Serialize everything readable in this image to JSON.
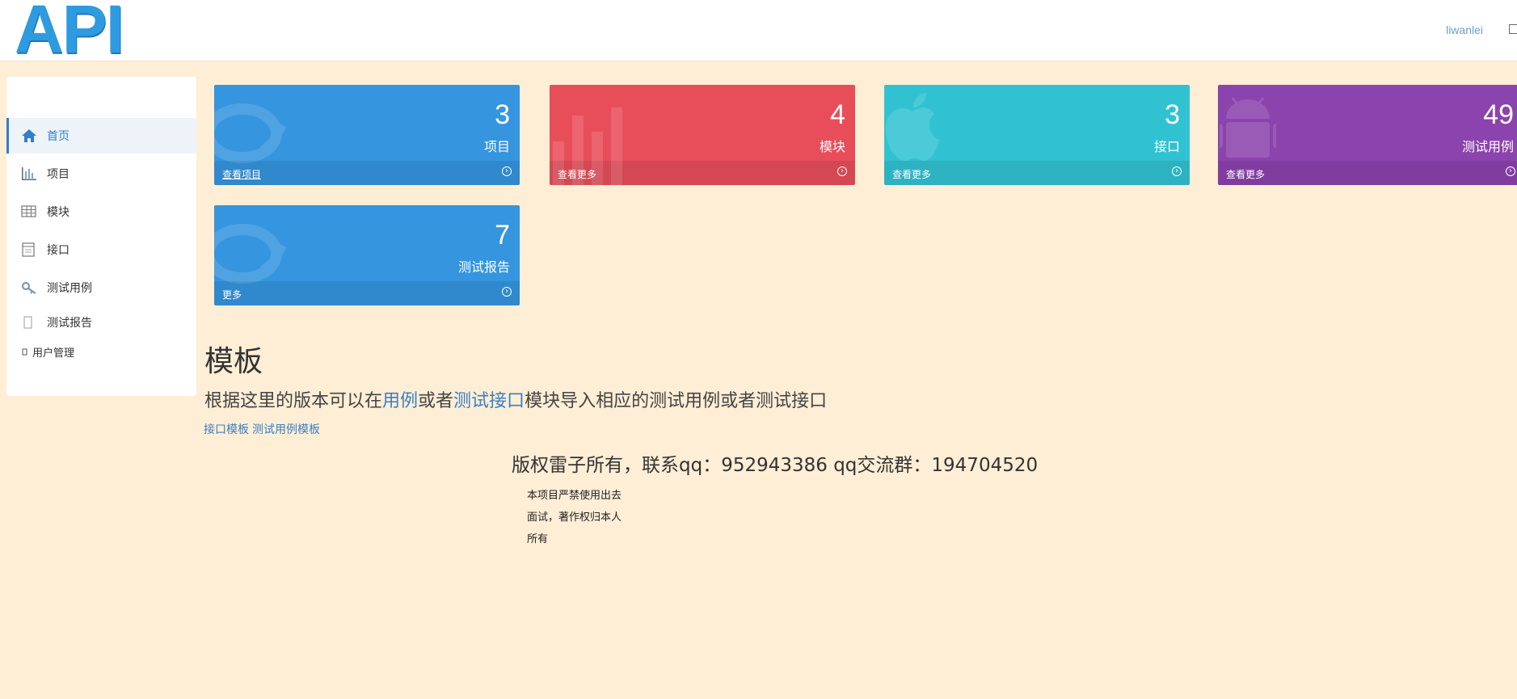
{
  "header": {
    "logo": "API",
    "username": "liwanlei"
  },
  "sidebar": {
    "items": [
      {
        "label": "首页",
        "icon": "home-icon"
      },
      {
        "label": "项目",
        "icon": "bar-chart-icon"
      },
      {
        "label": "模块",
        "icon": "table-icon"
      },
      {
        "label": "接口",
        "icon": "window-icon"
      },
      {
        "label": "测试用例",
        "icon": "key-icon"
      },
      {
        "label": "测试报告",
        "icon": "document-icon"
      },
      {
        "label": "用户管理",
        "icon": "user-icon"
      }
    ]
  },
  "cards": [
    {
      "count": "3",
      "label": "项目",
      "link": "查看项目",
      "color": "#3595de",
      "bg_icon": "chat-icon"
    },
    {
      "count": "4",
      "label": "模块",
      "link": "查看更多",
      "color": "#e84e5a",
      "bg_icon": "bar-chart-icon"
    },
    {
      "count": "3",
      "label": "接口",
      "link": "查看更多",
      "color": "#31c2d2",
      "bg_icon": "apple-icon"
    },
    {
      "count": "49",
      "label": "测试用例",
      "link": "查看更多",
      "color": "#8b43ad",
      "bg_icon": "android-icon"
    },
    {
      "count": "7",
      "label": "测试报告",
      "link": "更多",
      "color": "#3595de",
      "bg_icon": "chat-icon"
    }
  ],
  "template": {
    "title": "模板",
    "desc_pre": "根据这里的版本可以在",
    "desc_link1": "用例",
    "desc_mid": "或者",
    "desc_link2": "测试接口",
    "desc_post": "模块导入相应的测试用例或者测试接口",
    "link_interface": "接口模板",
    "link_case": "测试用例模板"
  },
  "footer": {
    "copyright": "版权雷子所有，联系qq：952943386 qq交流群：194704520",
    "notice_line1": "本项目严禁使用出去",
    "notice_line2": "面试，著作权归本人",
    "notice_line3": "所有"
  }
}
